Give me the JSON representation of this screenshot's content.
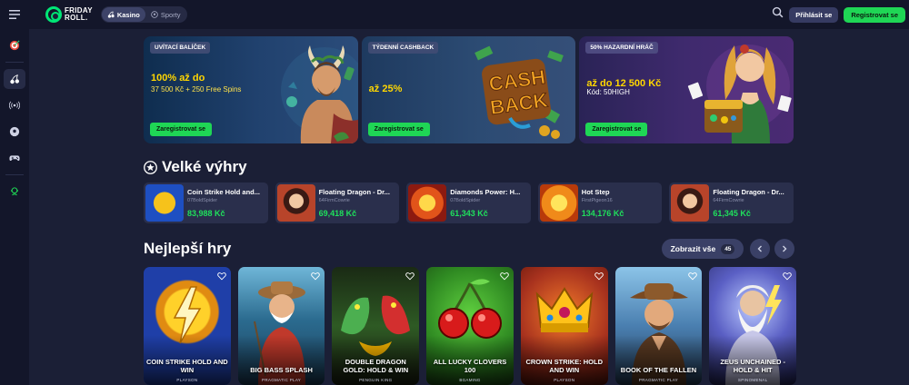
{
  "header": {
    "logo_line1": "FRIDAY",
    "logo_line2": "ROLL",
    "modes": [
      {
        "label": "Kasino",
        "active": true
      },
      {
        "label": "Sporty",
        "active": false
      }
    ],
    "login_label": "Přihlásit se",
    "register_label": "Registrovat se"
  },
  "sidebar": {
    "items": [
      {
        "icon": "target-icon"
      },
      {
        "icon": "cherries-icon",
        "active": true
      },
      {
        "icon": "live-broadcast-icon"
      },
      {
        "icon": "soccer-ball-icon"
      },
      {
        "icon": "gamepad-icon"
      },
      {
        "icon": "support-icon"
      }
    ]
  },
  "banners": [
    {
      "tag": "UVÍTACÍ BALÍČEK",
      "title": "100% až do",
      "subtitle": "37 500 Kč + 250 Free Spins",
      "cta": "Zaregistrovat se"
    },
    {
      "tag": "TÝDENNÍ CASHBACK",
      "title": "až 25%",
      "subtitle": "",
      "art_text_1": "CASH",
      "art_text_2": "BACK",
      "cta": "Zaregistrovat se"
    },
    {
      "tag": "50% HAZARDNÍ HRÁČ",
      "title": "až do 12 500 Kč",
      "subtitle": "Kód: 50HIGH",
      "cta": "Zaregistrovat se"
    }
  ],
  "big_wins": {
    "title": "Velké výhry",
    "items": [
      {
        "game": "Coin Strike Hold and...",
        "user": "07BoldSpider",
        "amount": "83,988 Kč",
        "thumb": "#1e4fc2"
      },
      {
        "game": "Floating Dragon - Dr...",
        "user": "64FirmCowrie",
        "amount": "69,418 Kč",
        "thumb": "#b8442a"
      },
      {
        "game": "Diamonds Power: H...",
        "user": "07BoldSpider",
        "amount": "61,343 Kč",
        "thumb": "#c2301a"
      },
      {
        "game": "Hot Step",
        "user": "FirstPigeon16",
        "amount": "134,176 Kč",
        "thumb": "#e06b10"
      },
      {
        "game": "Floating Dragon - Dr...",
        "user": "64FirmCowrie",
        "amount": "61,345 Kč",
        "thumb": "#b8442a"
      }
    ]
  },
  "best_games": {
    "title": "Nejlepší hry",
    "show_all_label": "Zobrazit vše",
    "count": "45",
    "items": [
      {
        "name": "COIN STRIKE HOLD AND WIN",
        "provider": "PLAYSON",
        "bg": "#1f3fa8"
      },
      {
        "name": "BIG BASS SPLASH",
        "provider": "PRAGMATIC PLAY",
        "bg": "#2b6b8f"
      },
      {
        "name": "DOUBLE DRAGON GOLD: HOLD & WIN",
        "provider": "PENGUIN KING",
        "bg": "#2e5a24"
      },
      {
        "name": "ALL LUCKY CLOVERS 100",
        "provider": "BGAMING",
        "bg": "#3d8a2a"
      },
      {
        "name": "CROWN STRIKE: HOLD AND WIN",
        "provider": "PLAYSON",
        "bg": "#a8321e"
      },
      {
        "name": "BOOK OF THE FALLEN",
        "provider": "PRAGMATIC PLAY",
        "bg": "#4a7fb0"
      },
      {
        "name": "ZEUS UNCHAINED - HOLD & HIT",
        "provider": "SPINOMENAL",
        "bg": "#3b3f8c"
      }
    ]
  }
}
